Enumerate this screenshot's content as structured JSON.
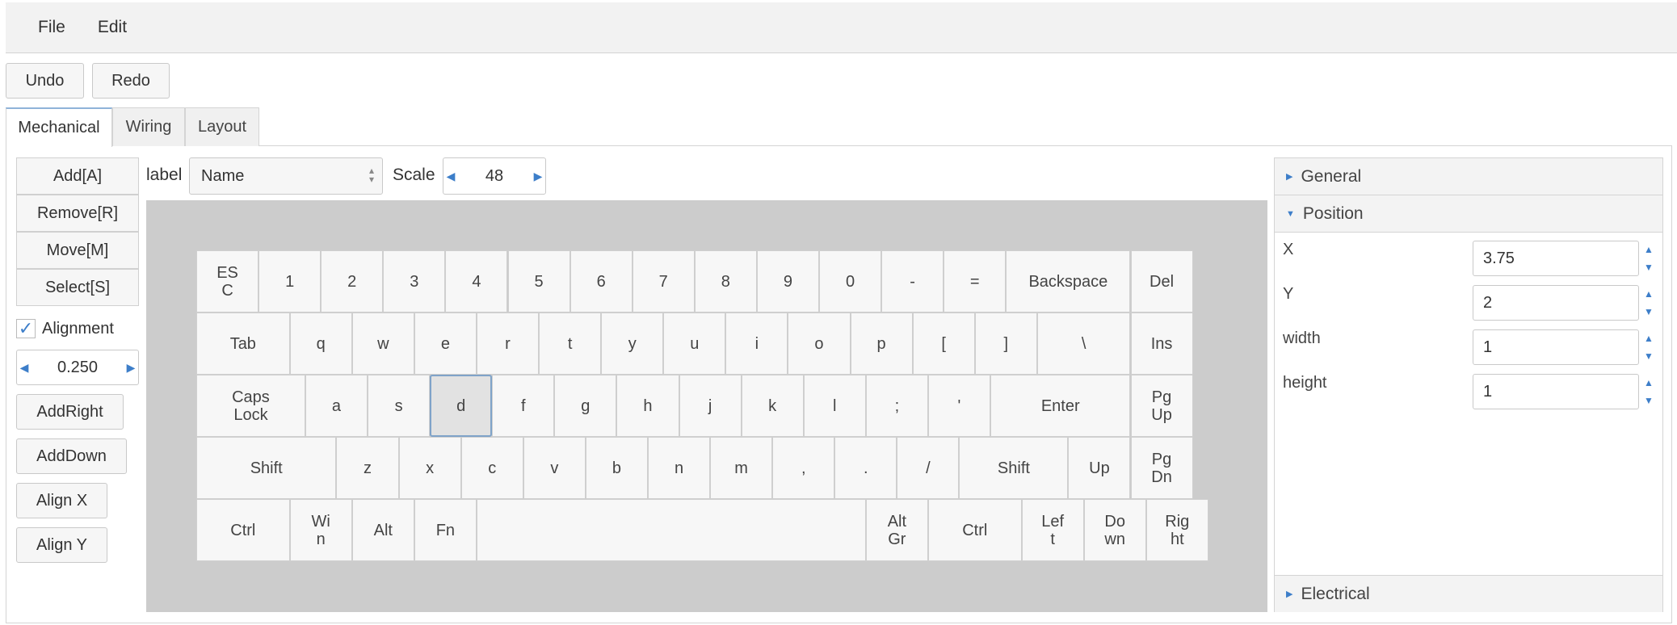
{
  "menu": {
    "file": "File",
    "edit": "Edit"
  },
  "toolbar": {
    "undo": "Undo",
    "redo": "Redo"
  },
  "tabs": {
    "mechanical": "Mechanical",
    "wiring": "Wiring",
    "layout": "Layout"
  },
  "tools": {
    "add": "Add[A]",
    "remove": "Remove[R]",
    "move": "Move[M]",
    "select": "Select[S]",
    "alignment_label": "Alignment",
    "alignment_value": "0.250",
    "add_right": "AddRight",
    "add_down": "AddDown",
    "align_x": "Align X",
    "align_y": "Align Y"
  },
  "controls": {
    "label_caption": "label",
    "label_value": "Name",
    "scale_caption": "Scale",
    "scale_value": "48"
  },
  "keyboard": {
    "rows": [
      [
        "ES\nC",
        "1",
        "2",
        "3",
        "4",
        "5",
        "6",
        "7",
        "8",
        "9",
        "0",
        "-",
        "=",
        "Backspace",
        "Del"
      ],
      [
        "Tab",
        "q",
        "w",
        "e",
        "r",
        "t",
        "y",
        "u",
        "i",
        "o",
        "p",
        "[",
        "]",
        "\\",
        "Ins"
      ],
      [
        "Caps\nLock",
        "a",
        "s",
        "d",
        "f",
        "g",
        "h",
        "j",
        "k",
        "l",
        ";",
        "'",
        "Enter",
        "Pg\nUp"
      ],
      [
        "Shift",
        "z",
        "x",
        "c",
        "v",
        "b",
        "n",
        "m",
        ",",
        ".",
        "/",
        "Shift",
        "Up",
        "Pg\nDn"
      ],
      [
        "Ctrl",
        "Wi\nn",
        "Alt",
        "Fn",
        "",
        "Alt\nGr",
        "Ctrl",
        "Lef\nt",
        "Do\nwn",
        "Rig\nht"
      ]
    ],
    "selected": "d"
  },
  "panel": {
    "general": "General",
    "position": "Position",
    "electrical": "Electrical",
    "x_label": "X",
    "x_value": "3.75",
    "y_label": "Y",
    "y_value": "2",
    "width_label": "width",
    "width_value": "1",
    "height_label": "height",
    "height_value": "1"
  }
}
